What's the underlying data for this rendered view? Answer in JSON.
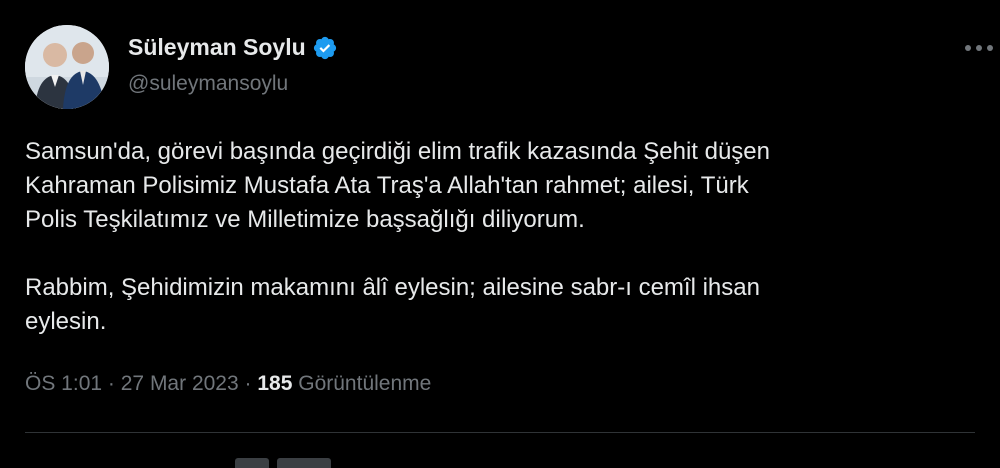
{
  "tweet": {
    "author": {
      "name": "Süleyman Soylu",
      "handle": "@suleymansoylu",
      "verified_icon": "verified-badge-icon",
      "badge_color": "#1d9bf0"
    },
    "more_icon": "more-horizontal-icon",
    "text_lines": [
      "Samsun'da, görevi başında geçirdiği elim trafik kazasında Şehit düşen",
      "Kahraman Polisimiz Mustafa Ata Traş'a Allah'tan rahmet; ailesi, Türk",
      "Polis Teşkilatımız ve Milletimize başsağlığı diliyorum.",
      "",
      "Rabbim, Şehidimizin makamını âlî eylesin; ailesine sabr-ı cemîl ihsan",
      "eylesin."
    ],
    "meta": {
      "time": "ÖS 1:01",
      "separator": "·",
      "date": "27 Mar 2023",
      "views_count": "185",
      "views_label": "Görüntülenme"
    }
  },
  "colors": {
    "background": "#000000",
    "text": "#e7e9ea",
    "secondary_text": "#71767b",
    "divider": "#2f3336",
    "accent": "#1d9bf0"
  }
}
